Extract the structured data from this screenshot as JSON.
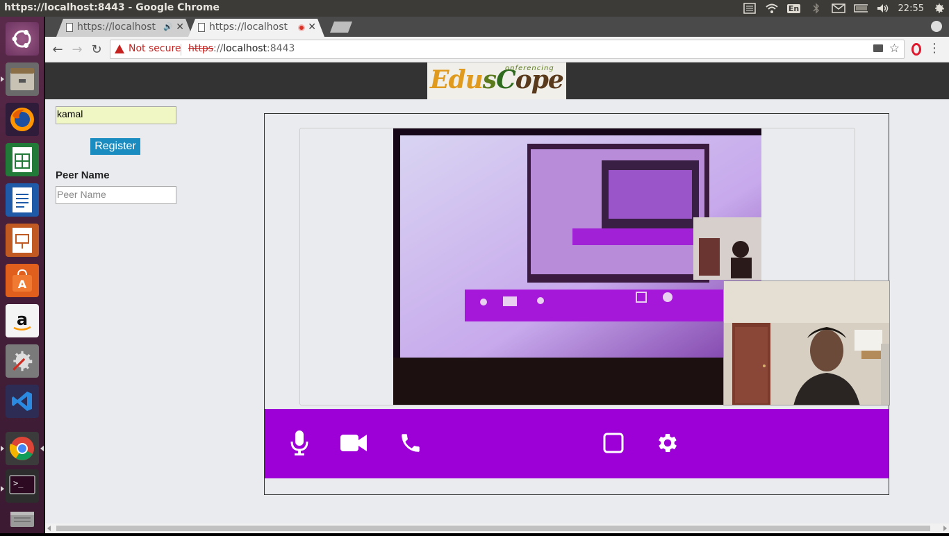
{
  "window": {
    "title": "https://localhost:8443 - Google Chrome"
  },
  "tray": {
    "keyboard_layout": "En",
    "clock": "22:55",
    "icons": [
      "menu-list-icon",
      "wifi-icon",
      "keyboard-icon",
      "bluetooth-icon",
      "mail-icon",
      "battery-icon",
      "volume-icon",
      "power-gear-icon"
    ]
  },
  "launcher": {
    "items": [
      "ubuntu-dash-icon",
      "files-icon",
      "firefox-icon",
      "libreoffice-calc-icon",
      "libreoffice-writer-icon",
      "libreoffice-impress-icon",
      "software-center-icon",
      "amazon-icon",
      "system-settings-icon",
      "vscode-icon",
      "chrome-icon",
      "terminal-icon",
      "trash-icon"
    ]
  },
  "tabs": [
    {
      "title": "https://localhost",
      "indicator": "audio-icon",
      "active": false
    },
    {
      "title": "https://localhost",
      "indicator": "recording-icon",
      "active": true
    }
  ],
  "toolbar": {
    "security_label": "Not secure",
    "url_scheme": "https",
    "url_sep": "://",
    "url_host": "localhost",
    "url_port": ":8443"
  },
  "app": {
    "logo_text_edu": "Edu",
    "logo_text_s": "s",
    "logo_text_c": "C",
    "logo_text_ope": "ope",
    "logo_subtext": "onferencing",
    "username_value": "kamal",
    "register_label": "Register",
    "peer_label": "Peer Name",
    "peer_placeholder": "Peer Name"
  },
  "controls": {
    "items": [
      "microphone-icon",
      "video-camera-icon",
      "phone-icon",
      "fullscreen-icon",
      "settings-gear-icon"
    ],
    "bar_color": "#9d00d6"
  }
}
